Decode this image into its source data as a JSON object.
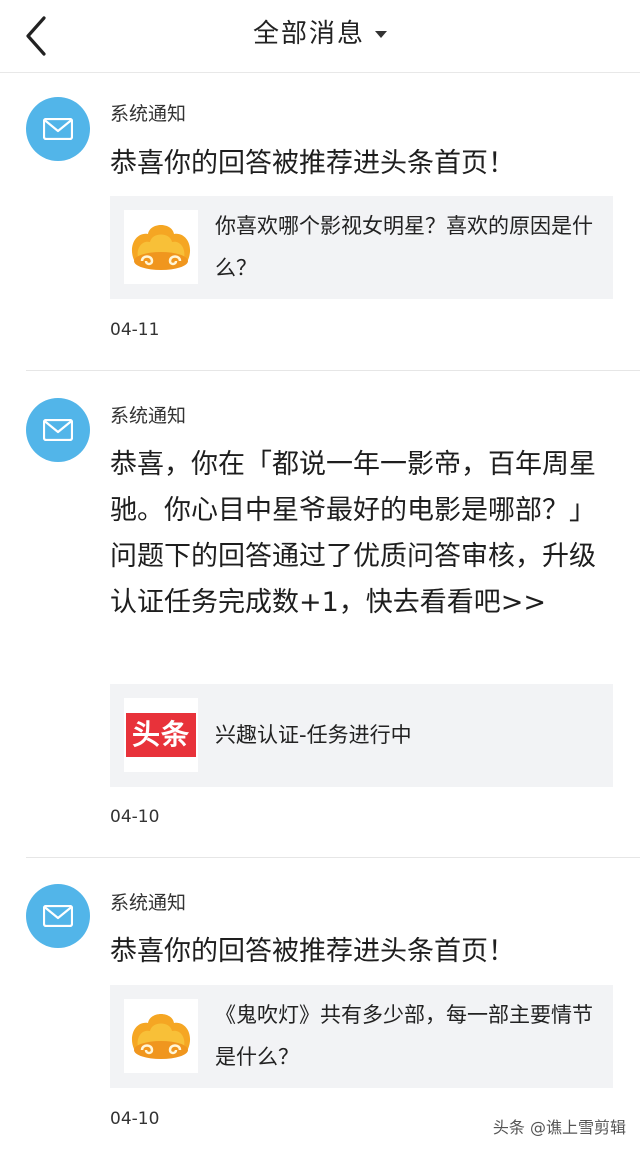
{
  "header": {
    "title": "全部消息",
    "back_icon": "chevron-left-icon",
    "dropdown_icon": "caret-down-icon"
  },
  "colors": {
    "avatar_blue": "#52b5e9",
    "card_bg": "#f2f3f5",
    "toutiao_red": "#e8323a",
    "medal_orange": "#f5a623"
  },
  "messages": [
    {
      "sender": "系统通知",
      "text": "恭喜你的回答被推荐进头条首页！",
      "card": {
        "thumb_icon": "gold-medal-icon",
        "text": "你喜欢哪个影视女明星？喜欢的原因是什么？"
      },
      "date": "04-11"
    },
    {
      "sender": "系统通知",
      "text": "恭喜，你在「都说一年一影帝，百年周星驰。你心目中星爷最好的电影是哪部？」问题下的回答通过了优质问答审核，升级认证任务完成数+1，快去看看吧>>",
      "card": {
        "thumb_icon": "toutiao-logo-icon",
        "thumb_label": "头条",
        "text": "兴趣认证-任务进行中"
      },
      "date": "04-10"
    },
    {
      "sender": "系统通知",
      "text": "恭喜你的回答被推荐进头条首页！",
      "card": {
        "thumb_icon": "gold-medal-icon",
        "text": "《鬼吹灯》共有多少部，每一部主要情节是什么？"
      },
      "date": "04-10"
    }
  ],
  "watermark": "头条 @谯上雪剪辑"
}
